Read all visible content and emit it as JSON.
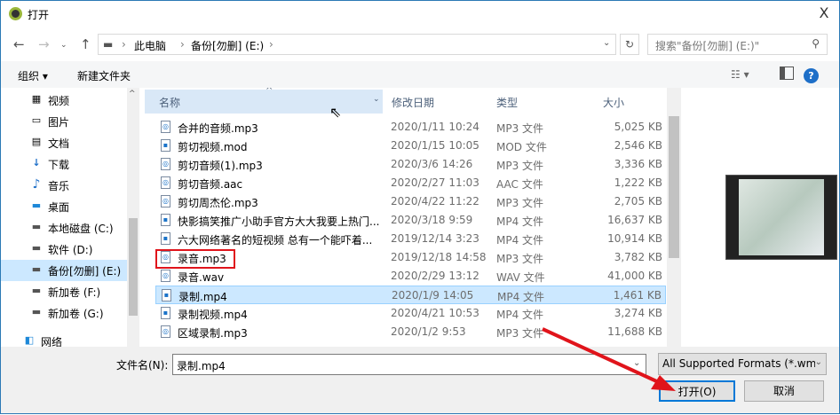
{
  "window": {
    "title": "打开",
    "close": "X"
  },
  "address": {
    "crumbs": [
      "此电脑",
      "备份[勿删] (E:)"
    ],
    "search_placeholder": "搜索\"备份[勿删] (E:)\""
  },
  "toolbar": {
    "organize": "组织 ▾",
    "new_folder": "新建文件夹",
    "help": "?"
  },
  "sidebar": {
    "items": [
      {
        "label": "视频",
        "icon": "▦"
      },
      {
        "label": "图片",
        "icon": "▭"
      },
      {
        "label": "文档",
        "icon": "▤"
      },
      {
        "label": "下载",
        "icon": "↓"
      },
      {
        "label": "音乐",
        "icon": "♪"
      },
      {
        "label": "桌面",
        "icon": "▬"
      },
      {
        "label": "本地磁盘 (C:)",
        "icon": "▬"
      },
      {
        "label": "软件 (D:)",
        "icon": "▬"
      },
      {
        "label": "备份[勿删] (E:)",
        "icon": "▬"
      },
      {
        "label": "新加卷 (F:)",
        "icon": "▬"
      },
      {
        "label": "新加卷 (G:)",
        "icon": "▬"
      },
      {
        "label": "网络",
        "icon": "◧"
      }
    ]
  },
  "columns": {
    "name": "名称",
    "date": "修改日期",
    "type": "类型",
    "size": "大小"
  },
  "files": [
    {
      "name": "合并的音频.mp3",
      "date": "2020/1/11 10:24",
      "type": "MP3 文件",
      "size": "5,025 KB",
      "icon": "audio"
    },
    {
      "name": "剪切视频.mod",
      "date": "2020/1/15 10:05",
      "type": "MOD 文件",
      "size": "2,546 KB",
      "icon": "video"
    },
    {
      "name": "剪切音频(1).mp3",
      "date": "2020/3/6 14:26",
      "type": "MP3 文件",
      "size": "3,336 KB",
      "icon": "audio"
    },
    {
      "name": "剪切音频.aac",
      "date": "2020/2/27 11:03",
      "type": "AAC 文件",
      "size": "1,222 KB",
      "icon": "audio"
    },
    {
      "name": "剪切周杰伦.mp3",
      "date": "2020/4/22 11:22",
      "type": "MP3 文件",
      "size": "2,705 KB",
      "icon": "audio"
    },
    {
      "name": "快影搞笑推广小助手官方大大我要上热门...",
      "date": "2020/3/18 9:59",
      "type": "MP4 文件",
      "size": "16,637 KB",
      "icon": "video"
    },
    {
      "name": "六大网络著名的短视频 总有一个能吓着...",
      "date": "2019/12/14 3:23",
      "type": "MP4 文件",
      "size": "10,914 KB",
      "icon": "video"
    },
    {
      "name": "录音.mp3",
      "date": "2019/12/18 14:58",
      "type": "MP3 文件",
      "size": "3,782 KB",
      "icon": "audio"
    },
    {
      "name": "录音.wav",
      "date": "2020/2/29 13:12",
      "type": "WAV 文件",
      "size": "41,000 KB",
      "icon": "audio"
    },
    {
      "name": "录制.mp4",
      "date": "2020/1/9 14:05",
      "type": "MP4 文件",
      "size": "1,461 KB",
      "icon": "video"
    },
    {
      "name": "录制视频.mp4",
      "date": "2020/4/21 10:53",
      "type": "MP4 文件",
      "size": "3,274 KB",
      "icon": "video"
    },
    {
      "name": "区域录制.mp3",
      "date": "2020/1/2 9:53",
      "type": "MP3 文件",
      "size": "11,688 KB",
      "icon": "audio"
    }
  ],
  "selected_index": 9,
  "highlight_index": 7,
  "footer": {
    "filename_label": "文件名(N):",
    "filename_value": "录制.mp4",
    "filter": "All Supported Formats (*.wm",
    "open": "打开(O)",
    "cancel": "取消"
  },
  "colors": {
    "accent": "#0078d7",
    "selection": "#cce8ff",
    "annotation": "#e0141b"
  }
}
